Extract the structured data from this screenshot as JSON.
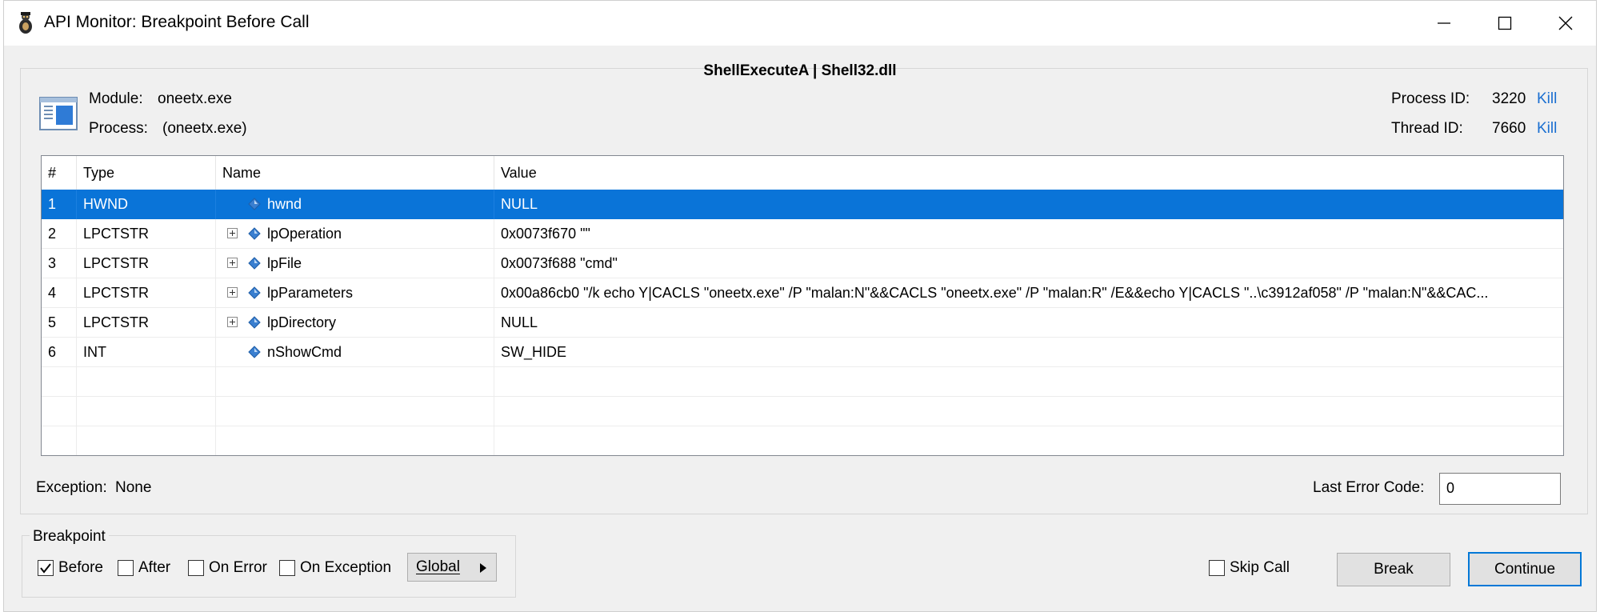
{
  "window": {
    "title": "API Monitor: Breakpoint Before Call",
    "icon": "api-monitor-app-icon"
  },
  "window_controls": {
    "minimize": "minimize-icon",
    "maximize": "maximize-icon",
    "close": "close-icon"
  },
  "function_title": "ShellExecuteA | Shell32.dll",
  "module": {
    "label": "Module:",
    "value": "oneetx.exe"
  },
  "process": {
    "label": "Process:",
    "value": "(oneetx.exe)"
  },
  "process_id": {
    "label": "Process ID:",
    "value": "3220",
    "kill": "Kill"
  },
  "thread_id": {
    "label": "Thread ID:",
    "value": "7660",
    "kill": "Kill"
  },
  "table": {
    "headers": [
      "#",
      "Type",
      "Name",
      "Value"
    ],
    "rows": [
      {
        "num": "1",
        "type": "HWND",
        "name": "hwnd",
        "value": "NULL",
        "expandable": false,
        "selected": true
      },
      {
        "num": "2",
        "type": "LPCTSTR",
        "name": "lpOperation",
        "value": "0x0073f670 \"\"",
        "expandable": true
      },
      {
        "num": "3",
        "type": "LPCTSTR",
        "name": "lpFile",
        "value": "0x0073f688 \"cmd\"",
        "expandable": true
      },
      {
        "num": "4",
        "type": "LPCTSTR",
        "name": "lpParameters",
        "value": "0x00a86cb0 \"/k echo Y|CACLS \"oneetx.exe\" /P \"malan:N\"&&CACLS \"oneetx.exe\" /P \"malan:R\" /E&&echo Y|CACLS \"..\\c3912af058\" /P \"malan:N\"&&CAC...",
        "expandable": true
      },
      {
        "num": "5",
        "type": "LPCTSTR",
        "name": "lpDirectory",
        "value": "NULL",
        "expandable": true
      },
      {
        "num": "6",
        "type": "INT",
        "name": "nShowCmd",
        "value": "SW_HIDE",
        "expandable": false
      }
    ]
  },
  "exception": {
    "label": "Exception:",
    "value": "None"
  },
  "last_error": {
    "label": "Last Error Code:",
    "value": "0"
  },
  "breakpoint": {
    "group_label": "Breakpoint",
    "before": {
      "label": "Before",
      "checked": true
    },
    "after": {
      "label": "After",
      "checked": false
    },
    "on_error": {
      "label": "On Error",
      "checked": false
    },
    "on_exception": {
      "label": "On Exception",
      "checked": false
    },
    "global_label": "Global"
  },
  "skip_call": {
    "label": "Skip Call",
    "checked": false
  },
  "buttons": {
    "break": "Break",
    "continue": "Continue"
  },
  "colors": {
    "selection": "#0a74d8",
    "link": "#1a6fd1",
    "default_button_border": "#0078d7"
  }
}
